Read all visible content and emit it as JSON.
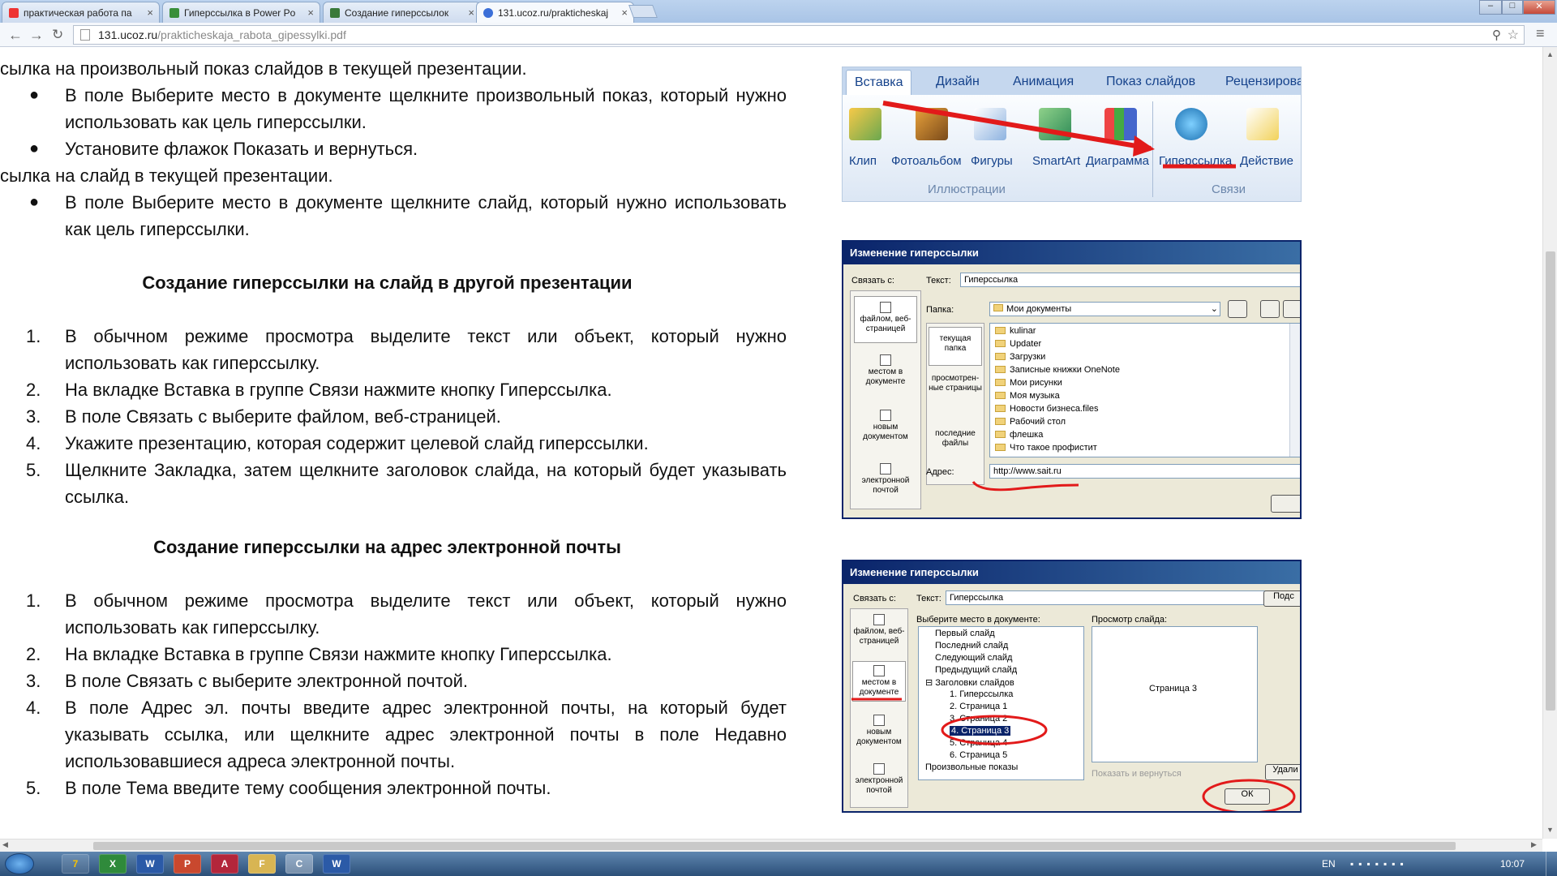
{
  "tabs": [
    {
      "title": "практическая работа па",
      "active": false,
      "favicon": "yandex-icon",
      "color": "#e33"
    },
    {
      "title": "Гиперссылка в Power Po",
      "active": false,
      "favicon": "globe-icon",
      "color": "#3a8f3a"
    },
    {
      "title": "Создание гиперссылок",
      "active": false,
      "favicon": "page-icon",
      "color": "#3a7a3a"
    },
    {
      "title": "131.ucoz.ru/prakticheskaj",
      "active": true,
      "favicon": "globe-icon",
      "color": "#3b6fd8"
    }
  ],
  "address": {
    "host": "131.ucoz.ru",
    "path": "/prakticheskaja_rabota_gipessylki.pdf"
  },
  "doc": {
    "l0": "сылка на произвольный показ слайдов в текущей презентации.",
    "b1": "В поле Выберите место в документе щелкните произвольный показ, который нужно использовать как цель гиперссылки.",
    "b2": "Установите флажок Показать и вернуться.",
    "l1": "сылка на слайд в текущей презентации.",
    "b3": "В поле Выберите место в документе щелкните слайд, который нужно использовать как цель гиперссылки.",
    "h1": "Создание гиперссылки на слайд в другой презентации",
    "s1": [
      {
        "n": "1.",
        "t": "В обычном режиме просмотра выделите текст или объект, который нужно использовать как гиперссылку."
      },
      {
        "n": "2.",
        "t": "На вкладке Вставка в группе Связи нажмите кнопку Гиперссылка."
      },
      {
        "n": "3.",
        "t": "В поле Связать с выберите файлом, веб-страницей."
      },
      {
        "n": "4.",
        "t": "Укажите презентацию, которая содержит целевой слайд гиперссылки."
      },
      {
        "n": "5.",
        "t": "Щелкните Закладка, затем щелкните заголовок слайда, на который будет указывать ссылка."
      }
    ],
    "h2": "Создание гиперссылки на адрес электронной почты",
    "s2": [
      {
        "n": "1.",
        "t": "В обычном режиме просмотра выделите текст или объект, который нужно использовать как гиперссылку."
      },
      {
        "n": "2.",
        "t": "На вкладке Вставка в группе Связи нажмите кнопку Гиперссылка."
      },
      {
        "n": "3.",
        "t": "В поле Связать с выберите электронной почтой."
      },
      {
        "n": "4.",
        "t": "В поле Адрес эл. почты введите адрес электронной почты, на который будет указывать ссылка, или щелкните адрес электронной почты в поле Недавно использовавшиеся адреса электронной почты."
      },
      {
        "n": "5.",
        "t": "В поле Тема введите тему сообщения электронной почты."
      }
    ]
  },
  "ribbon": {
    "tabs": [
      "Вставка",
      "Дизайн",
      "Анимация",
      "Показ слайдов",
      "Рецензирова"
    ],
    "buttons": [
      "Клип",
      "Фотоальбом",
      "Фигуры",
      "SmartArt",
      "Диаграмма",
      "Гиперссылка",
      "Действие"
    ],
    "groups": [
      "Иллюстрации",
      "Связи"
    ]
  },
  "dlg1": {
    "title": "Изменение гиперссылки",
    "link_label": "Связать с:",
    "text_label": "Текст:",
    "text_value": "Гиперссылка",
    "folder_label": "Папка:",
    "folder_value": "Мои документы",
    "left": [
      "файлом, веб-страницей",
      "местом в документе",
      "новым документом",
      "электронной почтой"
    ],
    "mid": [
      "текущая папка",
      "просмотрен-ные страницы",
      "последние файлы"
    ],
    "files": [
      "kulinar",
      "Updater",
      "Загрузки",
      "Записные книжки OneNote",
      "Мои рисунки",
      "Моя музыка",
      "Новости бизнеса.files",
      "Рабочий стол",
      "флешка",
      "Что такое профистит"
    ],
    "addr_label": "Адрес:",
    "addr_value": "http://www.sait.ru"
  },
  "dlg2": {
    "title": "Изменение гиперссылки",
    "link_label": "Связать с:",
    "text_label": "Текст:",
    "text_value": "Гиперссылка",
    "hint_btn": "Подс",
    "place_label": "Выберите место в документе:",
    "preview_label": "Просмотр слайда:",
    "left": [
      "файлом, веб-страницей",
      "местом в документе",
      "новым документом",
      "электронной почтой"
    ],
    "tree": [
      "Первый слайд",
      "Последний слайд",
      "Следующий слайд",
      "Предыдущий слайд",
      "Заголовки слайдов",
      "1. Гиперссылка",
      "2. Страница 1",
      "3. Страница 2",
      "4. Страница 3",
      "5. Страница 4",
      "6. Страница 5",
      "Произвольные показы"
    ],
    "preview_text": "Страница 3",
    "show_return": "Показать и вернуться",
    "delete_btn": "Удали",
    "ok": "ОК"
  },
  "taskbar": {
    "lang": "EN",
    "clock": "10:07",
    "apps": [
      "7",
      "X",
      "W",
      "P",
      "A",
      "F",
      "C",
      "W"
    ]
  }
}
